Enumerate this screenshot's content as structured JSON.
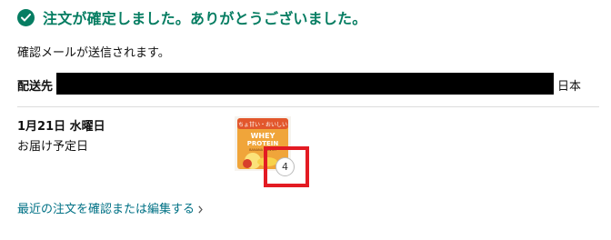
{
  "confirmation": {
    "title": "注文が確定しました。ありがとうございました。",
    "icon": "check-circle-icon",
    "color": "#067D62"
  },
  "email_note": "確認メールが送信されます。",
  "shipping": {
    "label": "配送先",
    "country": "日本"
  },
  "delivery": {
    "date": "1月21日 水曜日",
    "note": "お届け予定日"
  },
  "item": {
    "image_text": {
      "top": "ちょ甘い・おいしい",
      "brand_1": "WHEY",
      "brand_2": "PROTEIN",
      "small": "BANANA FLAVOR"
    },
    "quantity": "4"
  },
  "highlight": {
    "color": "#E31B23"
  },
  "link": {
    "label": "最近の注文を確認または編集する",
    "color": "#007185",
    "icon": "chevron-right-icon"
  }
}
